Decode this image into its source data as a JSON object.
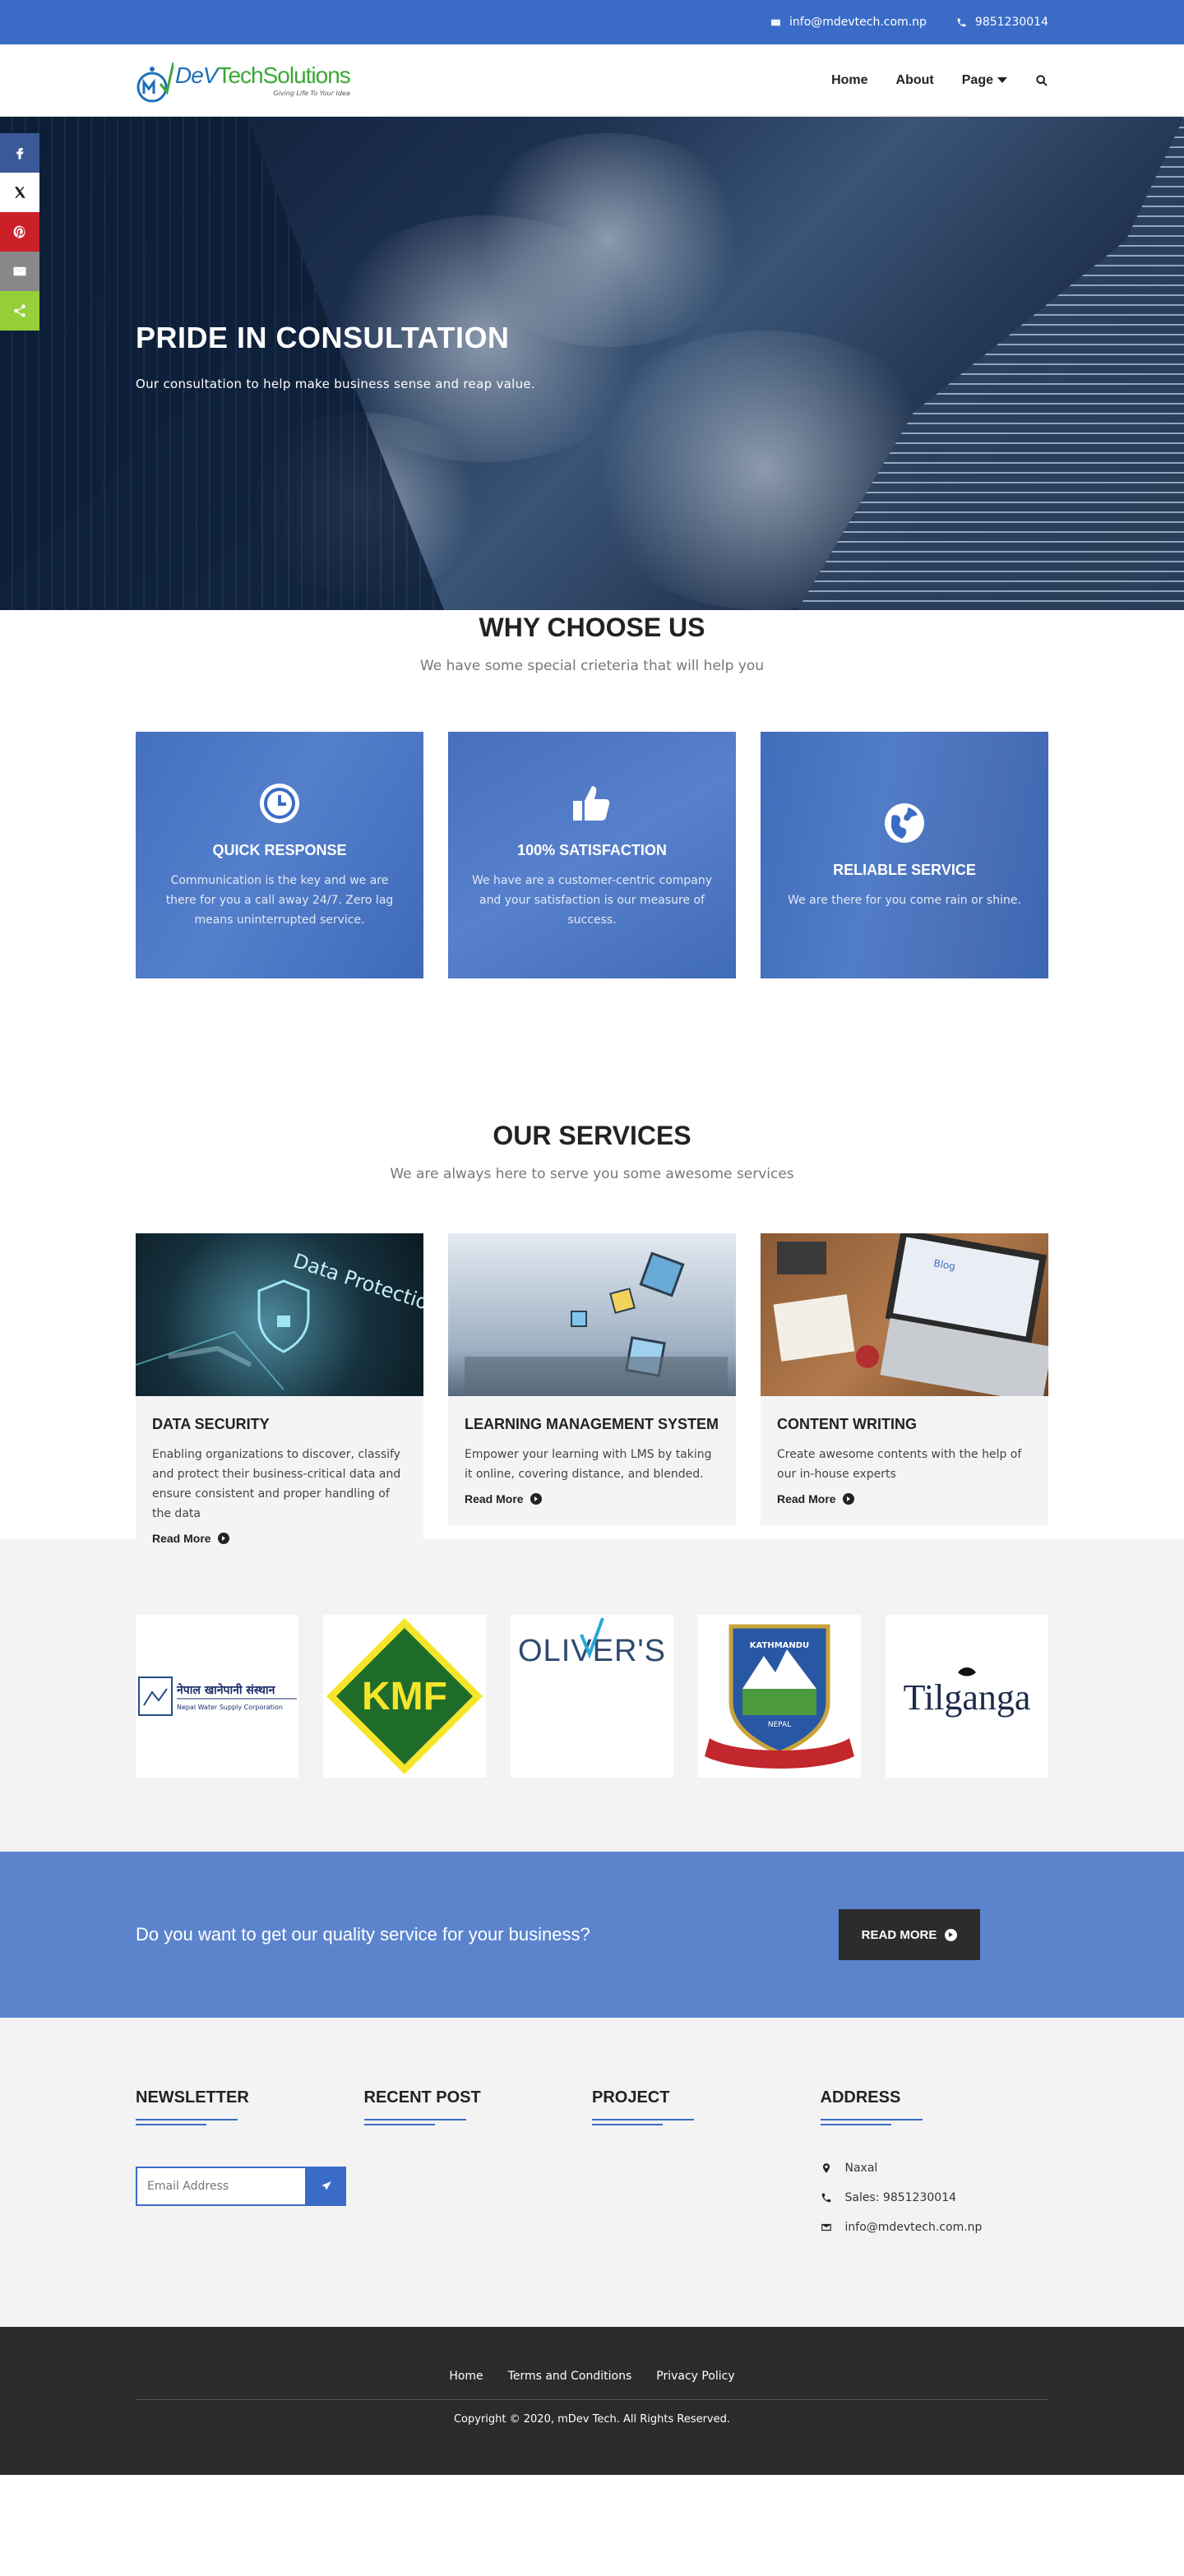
{
  "topbar": {
    "email": "info@mdevtech.com.np",
    "phone": "9851230014"
  },
  "brand": {
    "name_dev": "DeV",
    "name_ts": "TechSolutions",
    "tagline": "Giving Life To Your Idea"
  },
  "nav": {
    "home": "Home",
    "about": "About",
    "page": "Page"
  },
  "hero": {
    "title": "PRIDE IN CONSULTATION",
    "subtitle": "Our consultation to help make business sense and reap value."
  },
  "why": {
    "title": "WHY CHOOSE US",
    "subtitle": "We have some special crieteria that will help you",
    "cards": [
      {
        "title": "QUICK RESPONSE",
        "text": "Communication is the key and we are there for you a call away 24/7. Zero lag means uninterrupted service.",
        "icon": "clock-icon"
      },
      {
        "title": "100% SATISFACTION",
        "text": "We have are a customer-centric company and your satisfaction is our measure of success.",
        "icon": "thumbs-up-icon"
      },
      {
        "title": "RELIABLE SERVICE",
        "text": "We are there for you come rain or shine.",
        "icon": "globe-icon"
      }
    ]
  },
  "services": {
    "title": "OUR SERVICES",
    "subtitle": "We are always here to serve you some awesome services",
    "items": [
      {
        "title": "DATA SECURITY",
        "text": "Enabling organizations to discover, classify and protect their business-critical data and ensure consistent and proper handling of the data",
        "link": "Read More",
        "img_text": "Data Protection"
      },
      {
        "title": "LEARNING MANAGEMENT SYSTEM",
        "text": "Empower your learning with LMS by taking it online, covering distance, and blended.",
        "link": "Read More"
      },
      {
        "title": "CONTENT WRITING",
        "text": "Create awesome contents with the help of our in-house experts",
        "link": "Read More",
        "img_text": "Blog"
      }
    ]
  },
  "clients": [
    {
      "name": "नेपाल खानेपानी संस्थान",
      "sub": "Nepal Water Supply Corporation"
    },
    {
      "name": "KMF"
    },
    {
      "name": "OLIVER'S"
    },
    {
      "name": "KATHMANDU",
      "sub": "NEPAL"
    },
    {
      "name": "Tilganga"
    }
  ],
  "cta": {
    "text": "Do you want to get our quality service for your business?",
    "button": "READ MORE"
  },
  "footer": {
    "newsletter": "NEWSLETTER",
    "recent_post": "RECENT POST",
    "project": "PROJECT",
    "address": "ADDRESS",
    "email_placeholder": "Email Address",
    "addr_location": "Naxal",
    "addr_phone": "Sales: 9851230014",
    "addr_email": "info@mdevtech.com.np",
    "links": [
      "Home",
      "Terms and Conditions",
      "Privacy Policy"
    ],
    "copyright": "Copyright © 2020, mDev Tech. All Rights Reserved."
  },
  "colors": {
    "primary": "#3a6cc7",
    "cta_bg": "#5b84cd",
    "dark": "#2b2b2b",
    "light_bg": "#f3f3f3"
  }
}
